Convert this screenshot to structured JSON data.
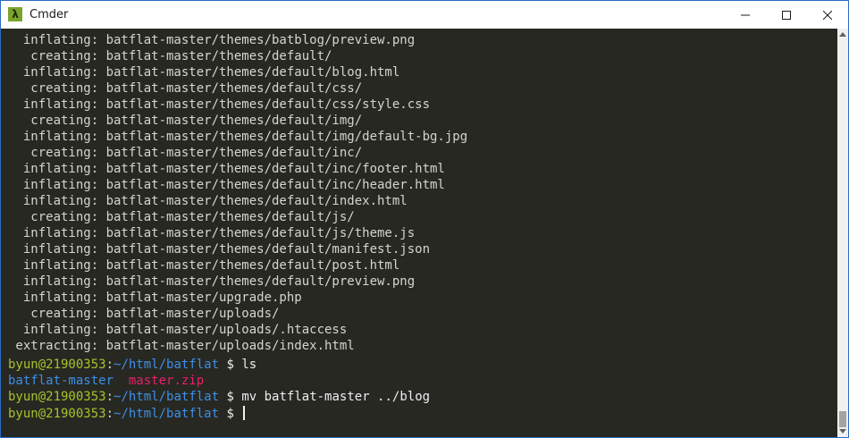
{
  "window": {
    "title": "Cmder",
    "icon": "lambda-icon",
    "icon_glyph": "λ",
    "minimize_icon": "minimize-icon",
    "maximize_icon": "maximize-icon",
    "close_icon": "close-icon"
  },
  "terminal": {
    "output": [
      "  inflating: batflat-master/themes/batblog/preview.png",
      "   creating: batflat-master/themes/default/",
      "  inflating: batflat-master/themes/default/blog.html",
      "   creating: batflat-master/themes/default/css/",
      "  inflating: batflat-master/themes/default/css/style.css",
      "   creating: batflat-master/themes/default/img/",
      "  inflating: batflat-master/themes/default/img/default-bg.jpg",
      "   creating: batflat-master/themes/default/inc/",
      "  inflating: batflat-master/themes/default/inc/footer.html",
      "  inflating: batflat-master/themes/default/inc/header.html",
      "  inflating: batflat-master/themes/default/index.html",
      "   creating: batflat-master/themes/default/js/",
      "  inflating: batflat-master/themes/default/js/theme.js",
      "  inflating: batflat-master/themes/default/manifest.json",
      "  inflating: batflat-master/themes/default/post.html",
      "  inflating: batflat-master/themes/default/preview.png",
      "  inflating: batflat-master/upgrade.php",
      "   creating: batflat-master/uploads/",
      "  inflating: batflat-master/uploads/.htaccess",
      " extracting: batflat-master/uploads/index.html"
    ],
    "prompt": {
      "user_host": "byun@21900353",
      "colon": ":",
      "path": "~/html/batflat",
      "symbol": "$"
    },
    "commands": [
      "ls",
      "mv batflat-master ../blog",
      ""
    ],
    "ls_output": {
      "dir": "batflat-master",
      "file": "master.zip"
    }
  },
  "colors": {
    "background": "#272822",
    "text": "#d5d5d0",
    "prompt_user": "#a6c32a",
    "prompt_path": "#3d8fe8",
    "directory": "#3d8fe8",
    "archive": "#e8206a"
  }
}
